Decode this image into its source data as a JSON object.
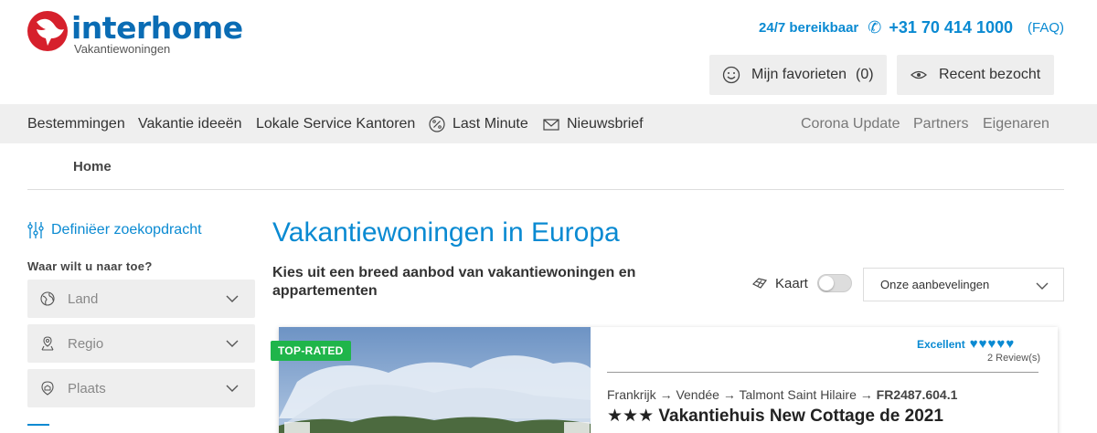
{
  "header": {
    "logo_word": "interhome",
    "logo_sub": "Vakantiewoningen",
    "availability": "24/7 bereikbaar",
    "phone": "+31 70 414 1000",
    "faq": "(FAQ)",
    "favorites_label": "Mijn favorieten",
    "favorites_count": "(0)",
    "recent_label": "Recent bezocht"
  },
  "nav": {
    "items": [
      "Bestemmingen",
      "Vakantie ideeën",
      "Lokale Service Kantoren",
      "Last Minute",
      "Nieuwsbrief"
    ],
    "right_items": [
      "Corona Update",
      "Partners",
      "Eigenaren"
    ]
  },
  "breadcrumb": {
    "home": "Home"
  },
  "sidebar": {
    "define_search": "Definiëer zoekopdracht",
    "where_label": "Waar wilt u naar toe?",
    "selects": [
      "Land",
      "Regio",
      "Plaats"
    ]
  },
  "main": {
    "title": "Vakantiewoningen in Europa",
    "subtitle": "Kies uit een breed aanbod van vakantiewoningen en appartementen",
    "map_label": "Kaart",
    "map_on": false,
    "sort_value": "Onze aanbevelingen"
  },
  "card": {
    "badge": "TOP-RATED",
    "rating_label": "Excellent",
    "rating_hearts": 5,
    "reviews": "2 Review(s)",
    "path": [
      "Frankrijk",
      "Vendée",
      "Talmont Saint Hilaire"
    ],
    "code": "FR2487.604.1",
    "stars": "★★★",
    "title": "Vakantiehuis New Cottage de 2021"
  },
  "colors": {
    "brand_blue": "#0a8ad2",
    "logo_red": "#d6202c",
    "badge_green": "#1fb54a"
  }
}
